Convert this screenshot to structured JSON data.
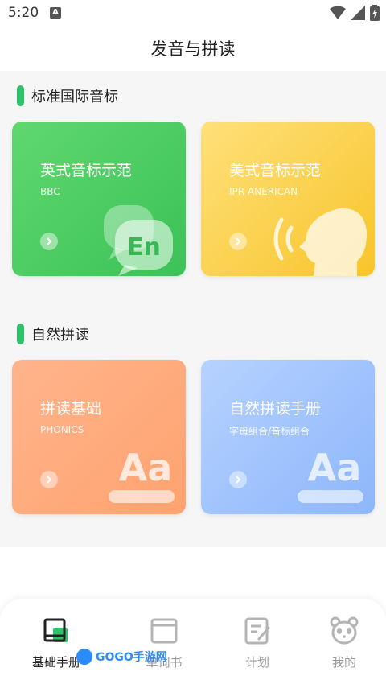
{
  "status_bar": {
    "time": "5:20",
    "badge": "A"
  },
  "page_title": "发音与拼读",
  "sections": {
    "ipa": {
      "title": "标准国际音标"
    },
    "phonics": {
      "title": "自然拼读"
    }
  },
  "cards": {
    "british": {
      "title": "英式音标示范",
      "subtitle": "BBC",
      "illustration_text": "En"
    },
    "american": {
      "title": "美式音标示范",
      "subtitle": "IPR ANERICAN"
    },
    "phonics_basics": {
      "title": "拼读基础",
      "subtitle": "PHONICS",
      "illustration_text": "Aa"
    },
    "phonics_handbook": {
      "title": "自然拼读手册",
      "subtitle": "字母组合/音标组合",
      "illustration_text": "Aa"
    }
  },
  "tabs": [
    {
      "label": "基础手册",
      "icon": "book-icon",
      "active": true
    },
    {
      "label": "单词书",
      "icon": "wordbook-icon",
      "active": false
    },
    {
      "label": "计划",
      "icon": "plan-icon",
      "active": false
    },
    {
      "label": "我的",
      "icon": "panda-icon",
      "active": false
    }
  ],
  "watermark": {
    "text": "GOGO手游网"
  },
  "colors": {
    "accent_green": "#2ec26a",
    "card_green": "#3bc258",
    "card_yellow": "#f7c52b",
    "card_orange": "#ffa26f",
    "card_blue": "#8db6fb"
  }
}
